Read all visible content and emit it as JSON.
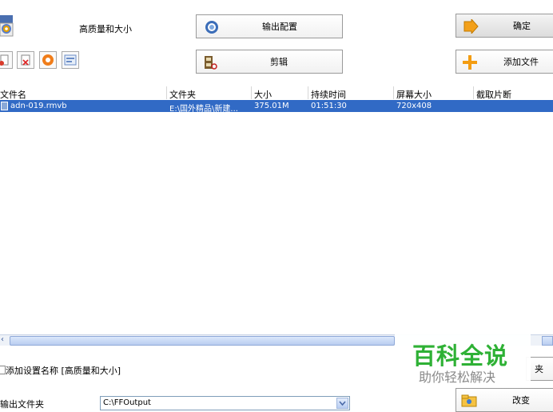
{
  "profile": {
    "name": "高质量和大小"
  },
  "toolbar": {
    "output_config_label": "输出配置",
    "clip_label": "剪辑",
    "ok_label": "确定",
    "add_file_label": "添加文件"
  },
  "table": {
    "headers": [
      "文件名",
      "文件夹",
      "大小",
      "持续时间",
      "屏幕大小",
      "截取片断"
    ],
    "rows": [
      {
        "filename": "adn-019.rmvb",
        "folder": "E:\\国外精品\\新建...",
        "size": "375.01M",
        "duration": "01:51:30",
        "screen": "720x408",
        "clip": ""
      }
    ]
  },
  "footer": {
    "add_setting_name_label": "添加设置名称 [高质量和大小]",
    "output_folder_label": "输出文件夹",
    "output_folder_value": "C:\\FFOutput",
    "change_label": "改变",
    "partial_label": "夹"
  },
  "watermark": {
    "title": "百科全说",
    "subtitle": "助你轻松解决"
  },
  "colors": {
    "selection": "#316ac5",
    "accent_green": "#2eb135"
  }
}
